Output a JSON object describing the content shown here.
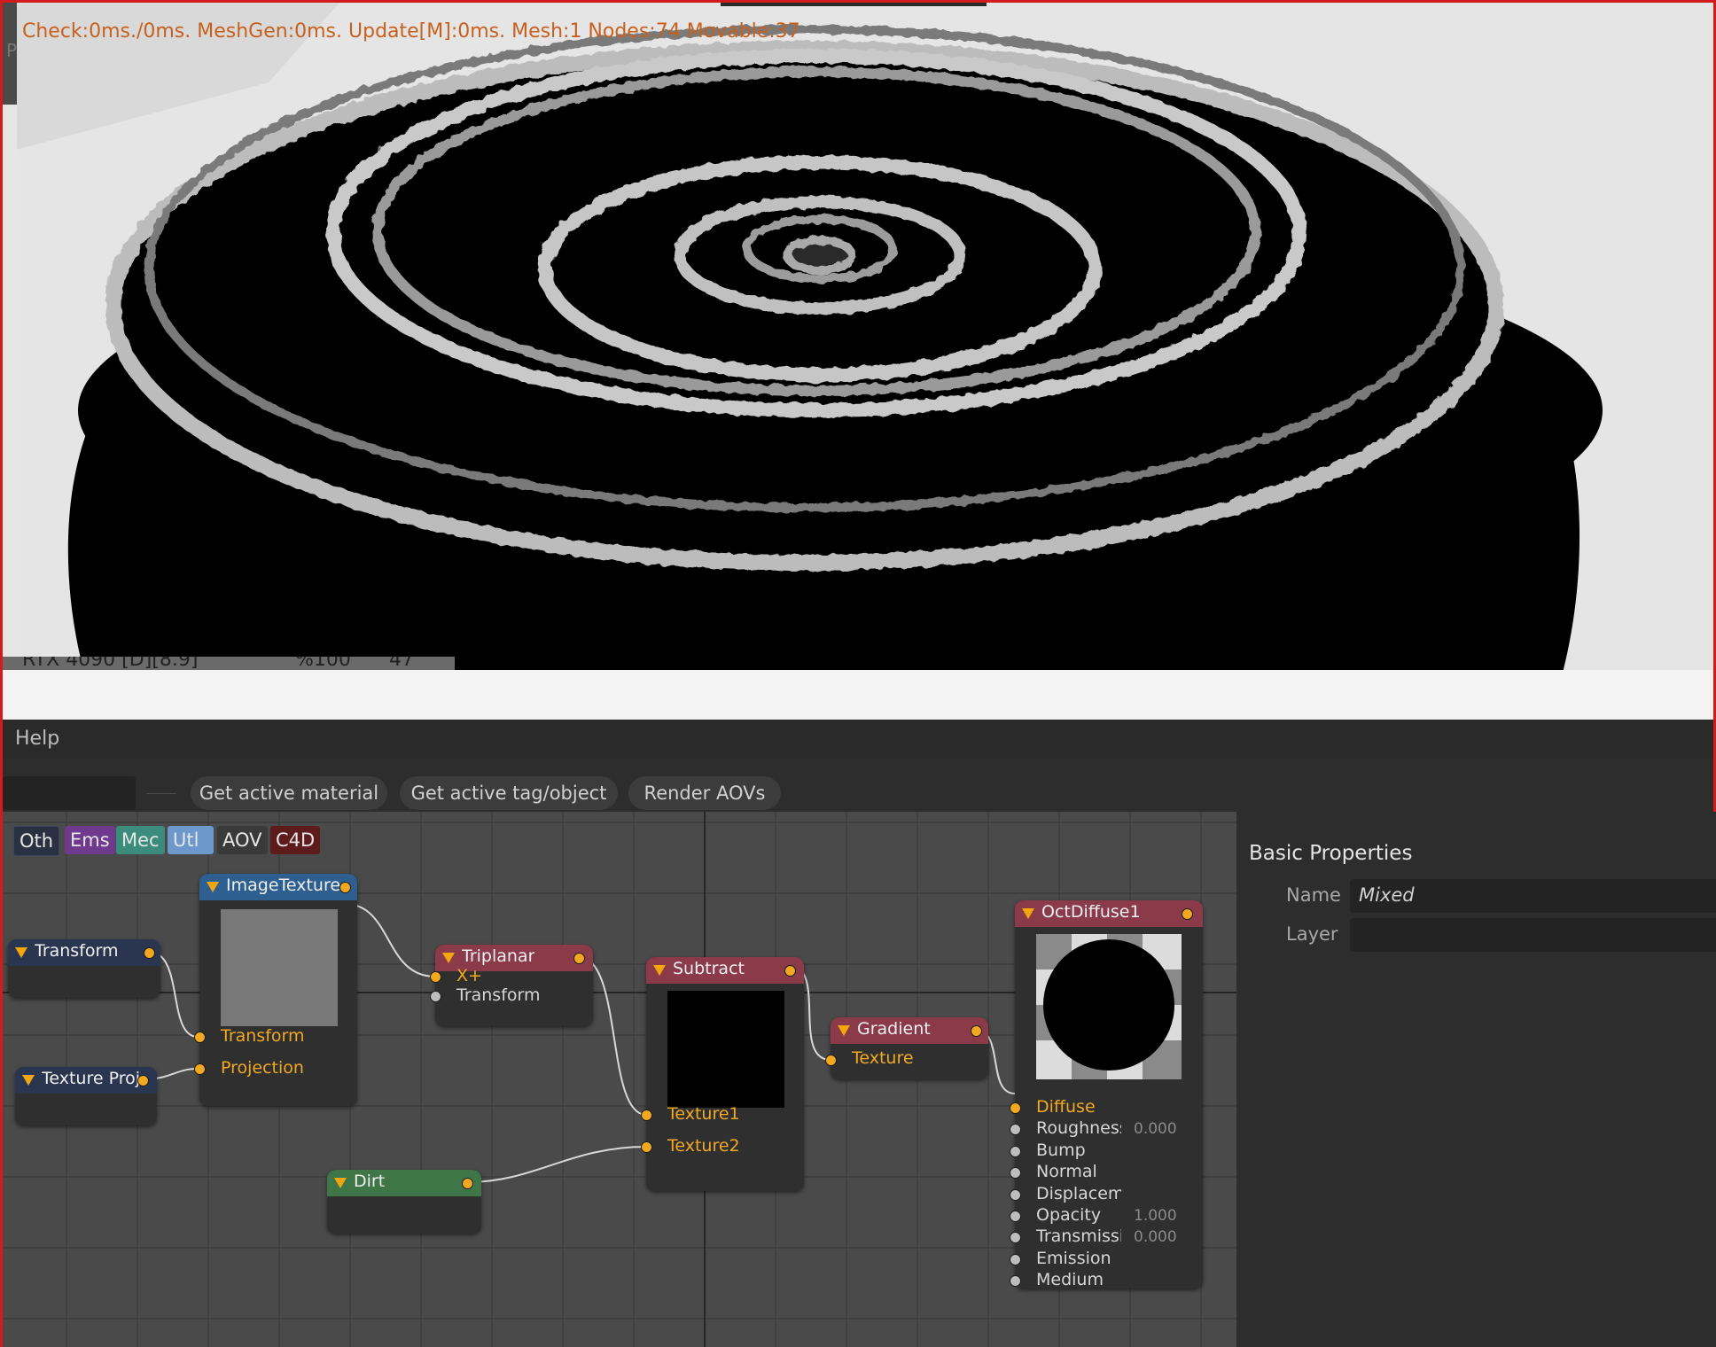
{
  "viewport": {
    "stats": "Check:0ms./0ms. MeshGen:0ms. Update[M]:0ms. Mesh:1 Nodes:74 Movable:37",
    "left_strip_label": "P",
    "gpu_bar": {
      "device": "RTX 4090 [D][8.9]",
      "percent": "%100",
      "value": "47"
    }
  },
  "menu": {
    "help": "Help"
  },
  "toolbar": {
    "buttons": [
      "Get active material",
      "Get active tag/object",
      "Render AOVs"
    ]
  },
  "tags": [
    "Oth",
    "Ems",
    "Mec",
    "Utl",
    "AOV",
    "C4D"
  ],
  "colors": {
    "tag_oth": "#293042",
    "tag_ems": "#6f3a8e",
    "tag_mec": "#3b8c7c",
    "tag_utl": "#6d98cc",
    "tag_aov": "#3a3a3a",
    "tag_c4d": "#5e1b1b",
    "node_blue": "#2d5f90",
    "node_navy": "#2a3550",
    "node_red": "#8a3a48",
    "node_green": "#3e7648",
    "port_orange": "#f2a920",
    "stats_text": "#c8601e",
    "frame_red": "#d21c1c"
  },
  "nodes": {
    "image_texture": {
      "title": "ImageTexture",
      "inputs": [
        "Transform",
        "Projection"
      ]
    },
    "transform": {
      "title": "Transform"
    },
    "texture_proj": {
      "title": "Texture Proj"
    },
    "triplanar": {
      "title": "Triplanar",
      "inputs": [
        "X+",
        "Transform"
      ]
    },
    "subtract": {
      "title": "Subtract",
      "inputs": [
        "Texture1",
        "Texture2"
      ]
    },
    "dirt": {
      "title": "Dirt"
    },
    "gradient": {
      "title": "Gradient",
      "inputs": [
        "Texture"
      ]
    },
    "oct_diffuse": {
      "title": "OctDiffuse1",
      "inputs": [
        {
          "label": "Diffuse",
          "value": ""
        },
        {
          "label": "Roughness",
          "value": "0.000"
        },
        {
          "label": "Bump",
          "value": ""
        },
        {
          "label": "Normal",
          "value": ""
        },
        {
          "label": "Displacement",
          "value": ""
        },
        {
          "label": "Opacity",
          "value": "1.000"
        },
        {
          "label": "Transmissi",
          "value": "0.000"
        },
        {
          "label": "Emission",
          "value": ""
        },
        {
          "label": "Medium",
          "value": ""
        }
      ]
    }
  },
  "properties": {
    "heading": "Basic Properties",
    "name_label": "Name",
    "name_value": "Mixed",
    "layer_label": "Layer",
    "layer_value": ""
  }
}
